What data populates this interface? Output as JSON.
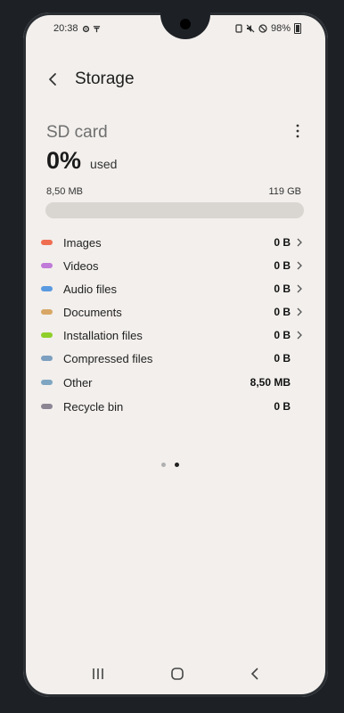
{
  "status_bar": {
    "time": "20:38",
    "battery": "98%"
  },
  "header": {
    "title": "Storage"
  },
  "storage": {
    "title": "SD card",
    "percent": "0%",
    "percent_suffix": "used",
    "used_amount": "8,50 MB",
    "total_capacity": "119 GB",
    "usage_fraction": 0.0
  },
  "categories": [
    {
      "label": "Images",
      "size": "0 B",
      "color": "#ef6e50",
      "chevron": true
    },
    {
      "label": "Videos",
      "size": "0 B",
      "color": "#c07ad8",
      "chevron": true
    },
    {
      "label": "Audio files",
      "size": "0 B",
      "color": "#5a9ae0",
      "chevron": true
    },
    {
      "label": "Documents",
      "size": "0 B",
      "color": "#d8a766",
      "chevron": true
    },
    {
      "label": "Installation files",
      "size": "0 B",
      "color": "#8fcf2a",
      "chevron": true
    },
    {
      "label": "Compressed files",
      "size": "0 B",
      "color": "#7d9fc0",
      "chevron": false
    },
    {
      "label": "Other",
      "size": "8,50 MB",
      "color": "#7ea6c2",
      "chevron": false
    },
    {
      "label": "Recycle bin",
      "size": "0 B",
      "color": "#8b8594",
      "chevron": false
    }
  ],
  "pager": {
    "count": 2,
    "active": 1
  },
  "icons": {
    "back": "back-arrow-icon",
    "more": "more-options-icon",
    "settings_status": "gear-icon",
    "nav_recents": "recent-apps-icon",
    "nav_home": "home-icon",
    "nav_back": "back-icon"
  }
}
